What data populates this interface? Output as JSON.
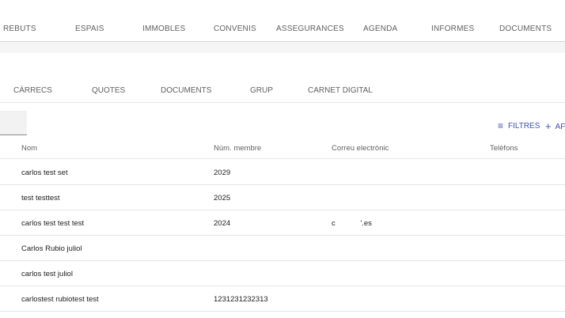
{
  "top_nav": [
    "REBUTS",
    "ESPAIS",
    "IMMOBLES",
    "CONVENIS",
    "ASSEGURANCES",
    "AGENDA",
    "INFORMES",
    "DOCUMENTS"
  ],
  "sub_tabs": [
    "CÀRRECS",
    "QUOTES",
    "DOCUMENTS",
    "GRUP",
    "CARNET DIGITAL"
  ],
  "toolbar": {
    "filters_label": "FILTRES",
    "filters_icon": "filter-icon",
    "add_label": "AF",
    "add_icon": "plus-icon"
  },
  "table": {
    "headers": [
      "Nom",
      "Núm. membre",
      "Correu electrònic",
      "Telèfons"
    ],
    "rows": [
      [
        "carlos test set",
        "2029",
        "",
        ""
      ],
      [
        "test testtest",
        "2025",
        "",
        ""
      ],
      [
        "carlos test test test",
        "2024",
        "c            '.es",
        ""
      ],
      [
        "Carlos Rubio juliol",
        "",
        "",
        ""
      ],
      [
        "carlos test juliol",
        "",
        "",
        ""
      ],
      [
        "carlostest rubiotest test",
        "1231231232313",
        "",
        ""
      ]
    ]
  },
  "colors": {
    "accent": "#3f51b5",
    "text": "#212121",
    "muted": "#616161",
    "divider": "#e6e6e6"
  }
}
